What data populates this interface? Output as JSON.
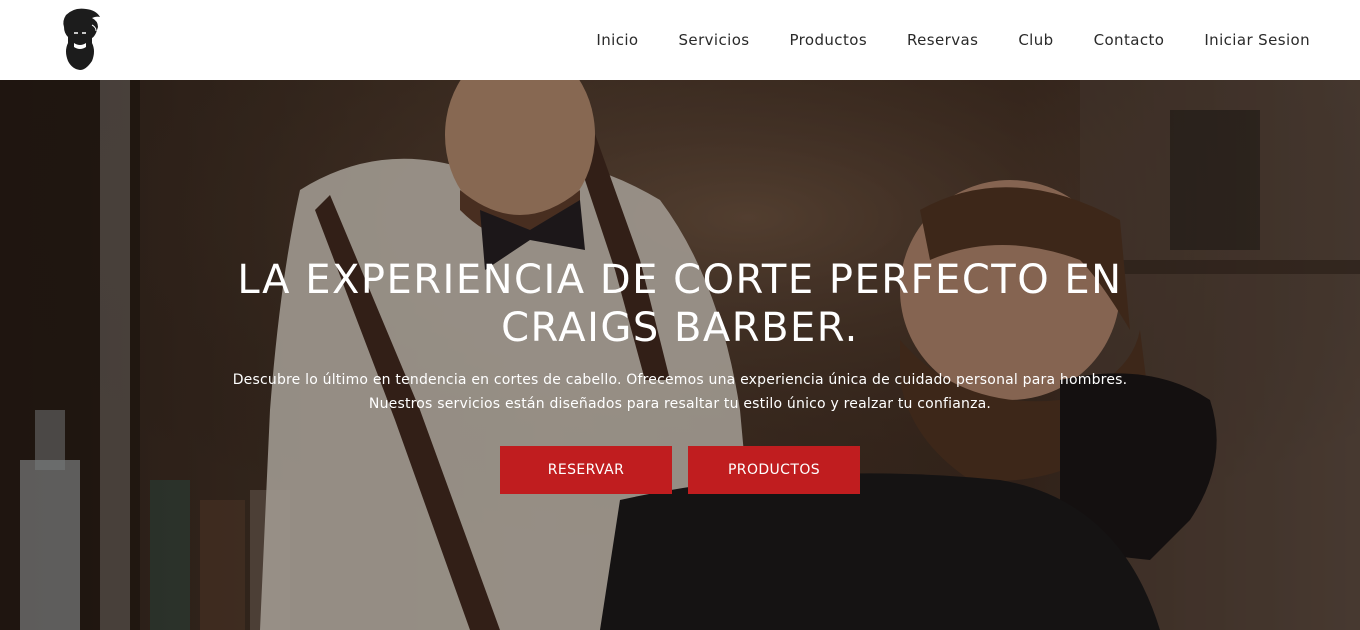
{
  "header": {
    "logo_icon": "bearded-man-logo-icon",
    "nav": [
      {
        "label": "Inicio"
      },
      {
        "label": "Servicios"
      },
      {
        "label": "Productos"
      },
      {
        "label": "Reservas"
      },
      {
        "label": "Club"
      },
      {
        "label": "Contacto"
      },
      {
        "label": "Iniciar Sesion"
      }
    ]
  },
  "hero": {
    "title_line1": "LA EXPERIENCIA DE CORTE PERFECTO EN",
    "title_line2": "CRAIGS BARBER.",
    "desc_line1": "Descubre lo último en tendencia en cortes de cabello. Ofrecemos una experiencia única de cuidado personal para hombres.",
    "desc_line2": "Nuestros servicios están diseñados para resaltar tu estilo único y realzar tu confianza.",
    "reserve_label": "RESERVAR",
    "products_label": "PRODUCTOS"
  },
  "colors": {
    "accent": "#c01d1f",
    "nav_text": "#2a2a2a"
  }
}
